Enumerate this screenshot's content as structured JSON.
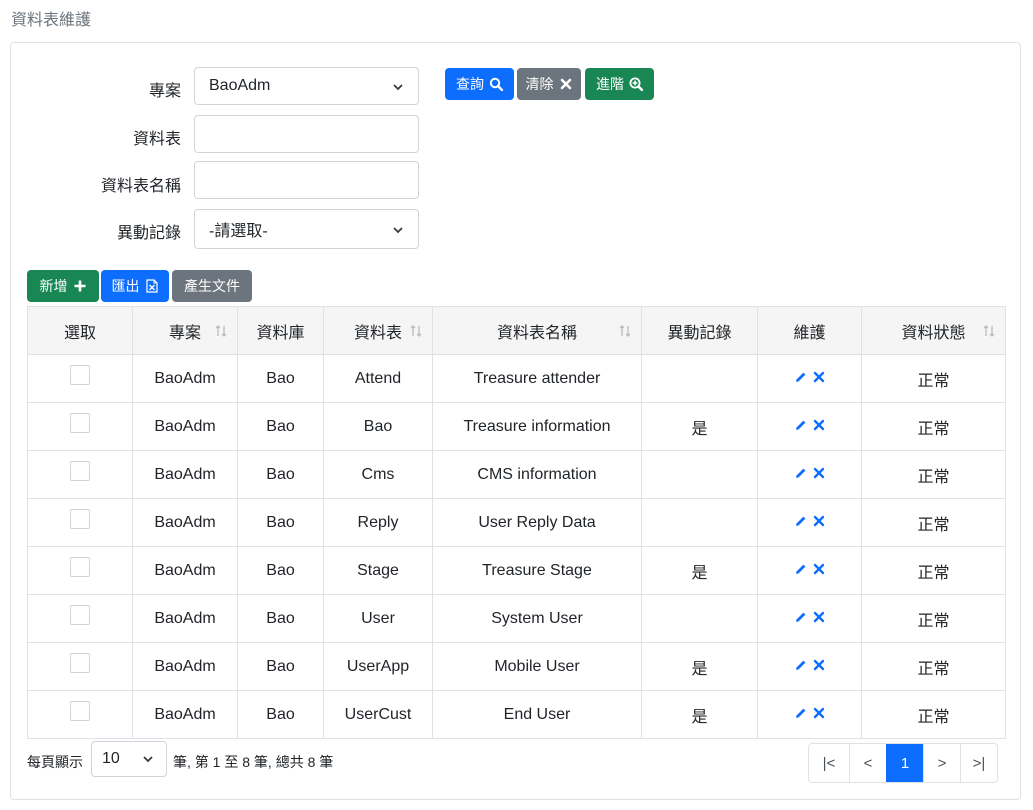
{
  "page_title": "資料表維護",
  "filters": {
    "project_label": "專案",
    "project_value": "BaoAdm",
    "table_label": "資料表",
    "table_value": "",
    "table_name_label": "資料表名稱",
    "table_name_value": "",
    "change_log_label": "異動記錄",
    "change_log_value": "-請選取-"
  },
  "search_buttons": {
    "query": "查詢",
    "clear": "清除",
    "advanced": "進階"
  },
  "toolbar": {
    "add": "新增",
    "export": "匯出",
    "generate_doc": "產生文件"
  },
  "table": {
    "headers": [
      "選取",
      "專案",
      "資料庫",
      "資料表",
      "資料表名稱",
      "異動記錄",
      "維護",
      "資料狀態"
    ],
    "rows": [
      {
        "project": "BaoAdm",
        "db": "Bao",
        "table": "Attend",
        "name": "Treasure attender",
        "log": "",
        "status": "正常"
      },
      {
        "project": "BaoAdm",
        "db": "Bao",
        "table": "Bao",
        "name": "Treasure information",
        "log": "是",
        "status": "正常"
      },
      {
        "project": "BaoAdm",
        "db": "Bao",
        "table": "Cms",
        "name": "CMS information",
        "log": "",
        "status": "正常"
      },
      {
        "project": "BaoAdm",
        "db": "Bao",
        "table": "Reply",
        "name": "User Reply Data",
        "log": "",
        "status": "正常"
      },
      {
        "project": "BaoAdm",
        "db": "Bao",
        "table": "Stage",
        "name": "Treasure Stage",
        "log": "是",
        "status": "正常"
      },
      {
        "project": "BaoAdm",
        "db": "Bao",
        "table": "User",
        "name": "System User",
        "log": "",
        "status": "正常"
      },
      {
        "project": "BaoAdm",
        "db": "Bao",
        "table": "UserApp",
        "name": "Mobile User",
        "log": "是",
        "status": "正常"
      },
      {
        "project": "BaoAdm",
        "db": "Bao",
        "table": "UserCust",
        "name": "End User",
        "log": "是",
        "status": "正常"
      }
    ]
  },
  "footer": {
    "per_page_label": "每頁顯示",
    "page_size": "10",
    "summary": "筆, 第 1 至 8 筆, 總共 8 筆",
    "pager": [
      "|<",
      "<",
      "1",
      ">",
      ">|"
    ],
    "active_page": "1"
  },
  "colors": {
    "primary": "#0d6efd",
    "secondary": "#6c757d",
    "success": "#198754"
  },
  "icons": [
    "search-icon",
    "close-icon",
    "zoom-in-icon",
    "plus-icon",
    "excel-icon",
    "chevron-down-icon",
    "sort-icon",
    "edit-icon",
    "delete-icon"
  ]
}
